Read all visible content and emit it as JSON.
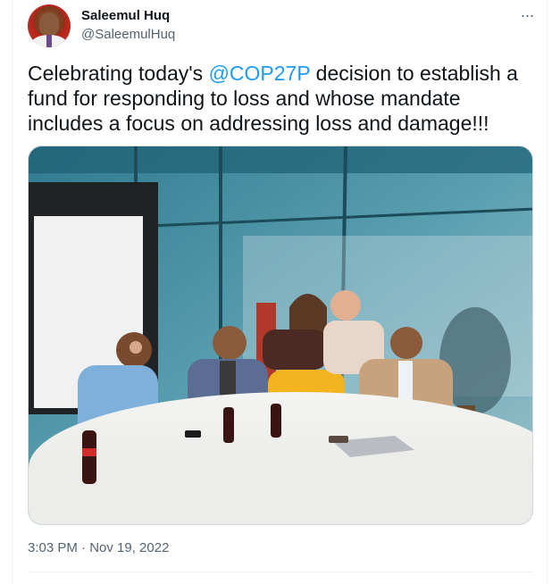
{
  "author": {
    "display_name": "Saleemul Huq",
    "handle": "@SaleemulHuq"
  },
  "menu": {
    "more_icon": "more-horizontal-icon",
    "more_glyph": "···"
  },
  "tweet": {
    "text_before": "Celebrating today's ",
    "mention": "@COP27P",
    "text_after": " decision to establish a fund for responding to loss and whose mandate includes a focus on addressing loss and damage!!!",
    "timestamp": "3:03 PM · Nov 19, 2022"
  },
  "colors": {
    "link": "#1d9bf0",
    "text": "#0f1419",
    "secondary": "#536471"
  }
}
